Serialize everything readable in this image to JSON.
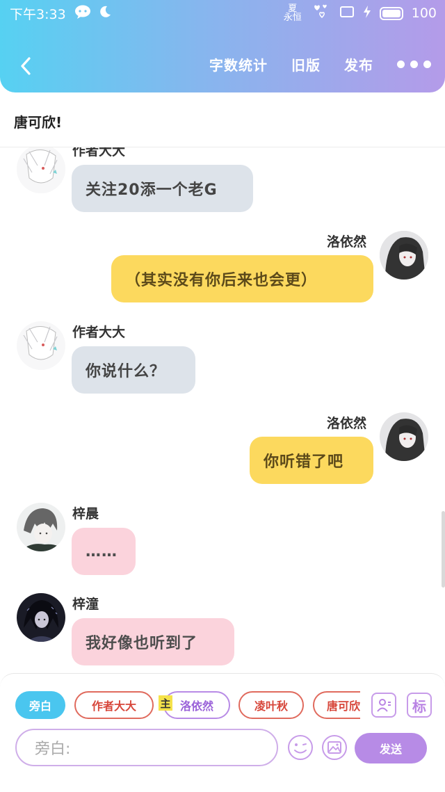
{
  "status_bar": {
    "time": "下午3:33",
    "signal_text_1": "夏",
    "signal_text_2": "永恒",
    "battery": "100"
  },
  "nav": {
    "word_count": "字数统计",
    "old_version": "旧版",
    "publish": "发布"
  },
  "story_title": "唐可欣!",
  "messages": [
    {
      "author": "作者大大",
      "text": "关注20添一个老G",
      "side": "left",
      "color": "grey"
    },
    {
      "author": "洛依然",
      "text": "（其实没有你后来也会更）",
      "side": "right",
      "color": "yellow"
    },
    {
      "author": "作者大大",
      "text": "你说什么？",
      "side": "left",
      "color": "grey"
    },
    {
      "author": "洛依然",
      "text": "你听错了吧",
      "side": "right",
      "color": "yellow"
    },
    {
      "author": "梓晨",
      "text": "……",
      "side": "left",
      "color": "pink"
    },
    {
      "author": "梓潼",
      "text": "我好像也听到了",
      "side": "left",
      "color": "pink"
    }
  ],
  "roles": [
    {
      "label": "旁白",
      "style": "active"
    },
    {
      "label": "作者大大",
      "style": "red"
    },
    {
      "label": "洛依然",
      "style": "purple"
    },
    {
      "label": "凌叶秋",
      "style": "red"
    },
    {
      "label": "唐可欣",
      "style": "red"
    }
  ],
  "main_badge": "主",
  "tag_button": "标",
  "input": {
    "placeholder": "旁白:"
  },
  "send_label": "发送",
  "colors": {
    "grey_bubble": "#dde3ea",
    "yellow_bubble": "#fcd95e",
    "pink_bubble": "#fbd3dc",
    "accent": "#b78be6"
  }
}
